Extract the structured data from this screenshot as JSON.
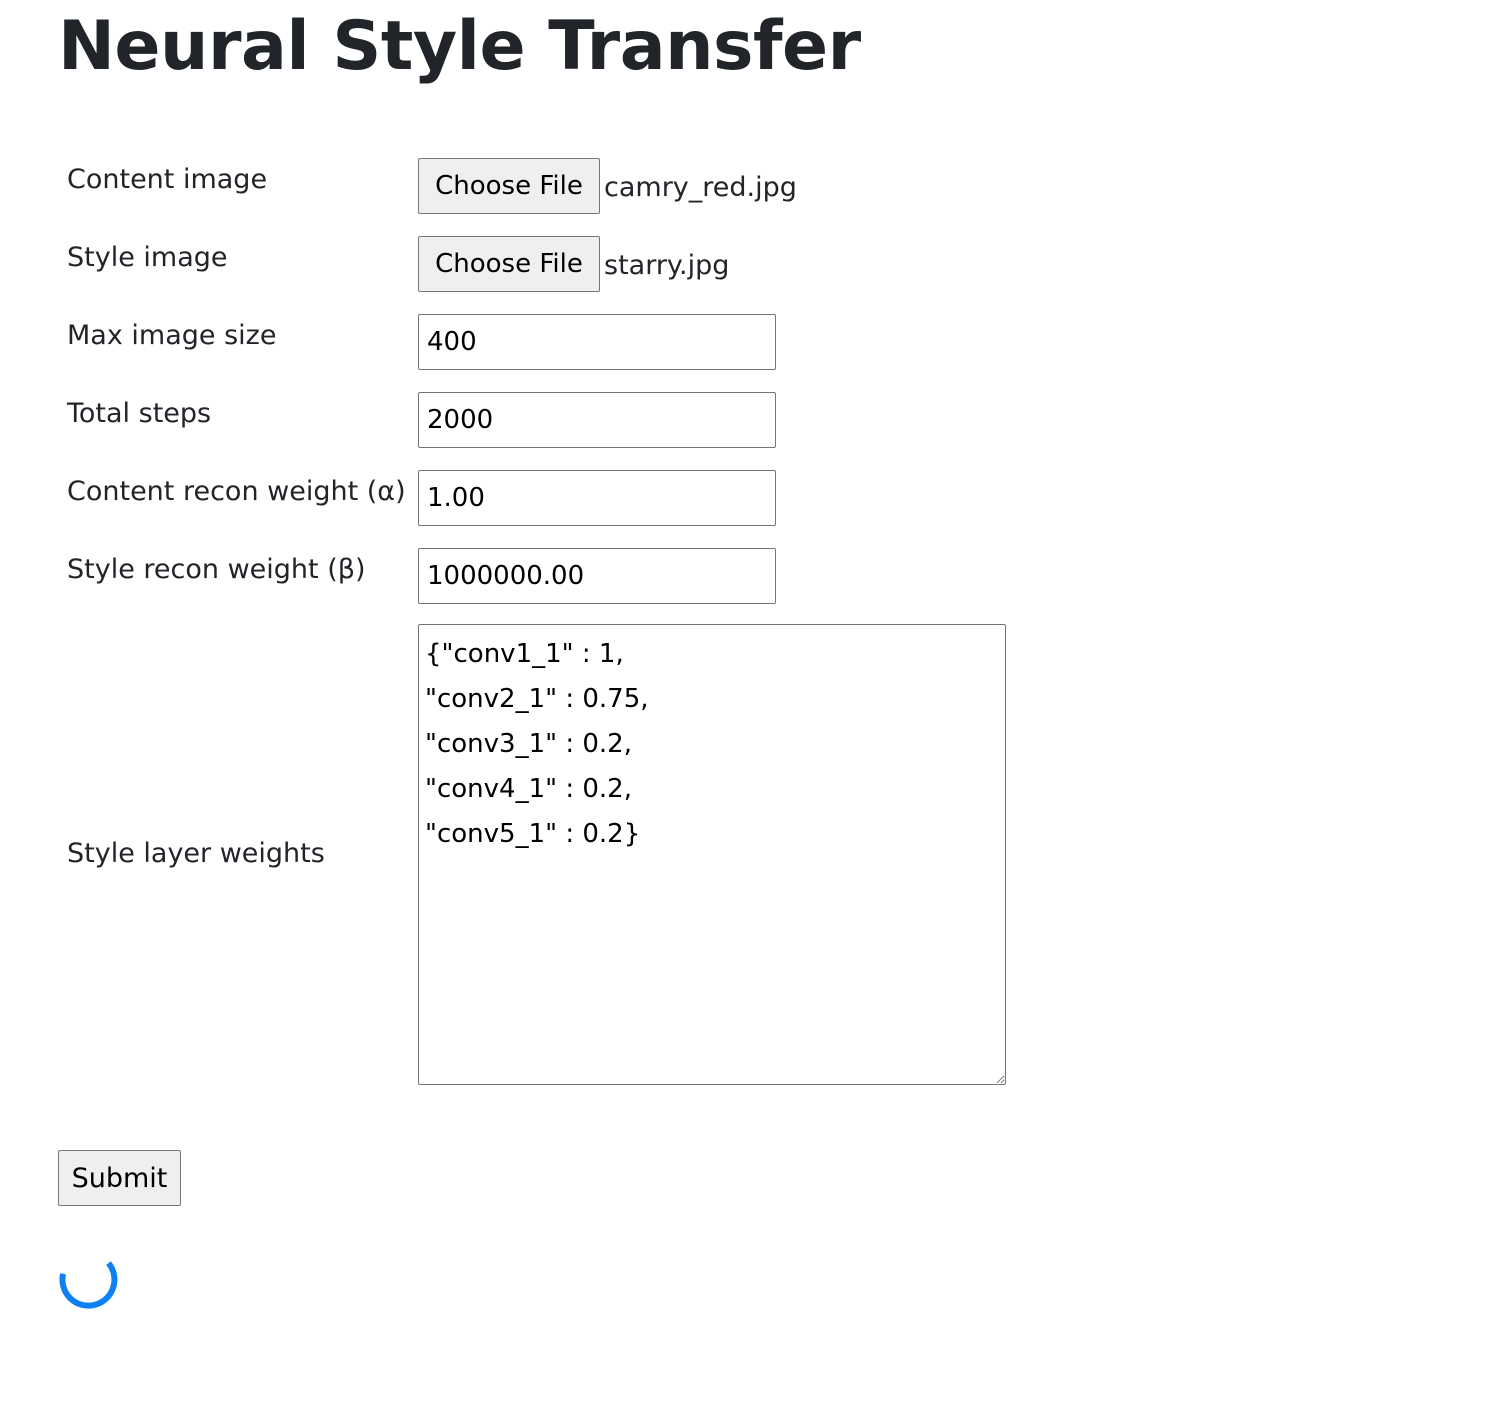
{
  "page": {
    "title": "Neural Style Transfer"
  },
  "form": {
    "content_image": {
      "label": "Content image",
      "button_label": "Choose File",
      "file_name": "camry_red.jpg"
    },
    "style_image": {
      "label": "Style image",
      "button_label": "Choose File",
      "file_name": "starry.jpg"
    },
    "max_image_size": {
      "label": "Max image size",
      "value": "400"
    },
    "total_steps": {
      "label": "Total steps",
      "value": "2000"
    },
    "content_weight": {
      "label": "Content recon weight (α)",
      "value": "1.00"
    },
    "style_weight": {
      "label": "Style recon weight (β)",
      "value": "1000000.00"
    },
    "layer_weights": {
      "label": "Style layer weights",
      "value": "{\"conv1_1\" : 1,\n\"conv2_1\" : 0.75,\n\"conv3_1\" : 0.2,\n\"conv4_1\" : 0.2,\n\"conv5_1\" : 0.2}"
    },
    "submit_label": "Submit"
  },
  "colors": {
    "spinner": "#0d80f2",
    "text": "#212529"
  },
  "icons": {
    "loading": "loading-spinner-icon"
  }
}
